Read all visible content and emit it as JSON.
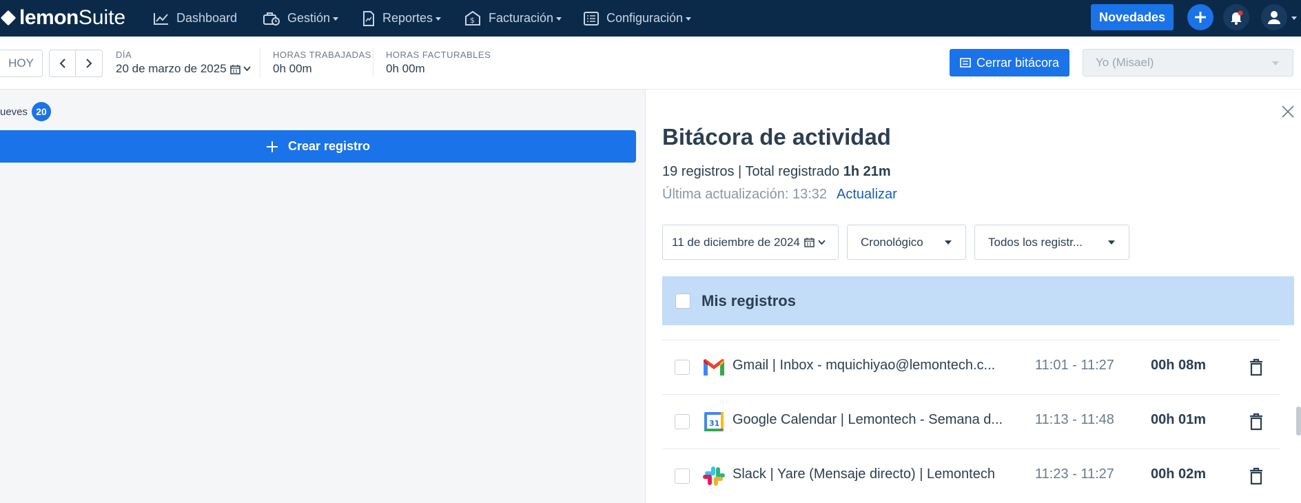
{
  "app": {
    "logo_bold": "lemon",
    "logo_light": "Suite"
  },
  "nav": {
    "items": [
      {
        "label": "Dashboard",
        "icon": "chart-line-icon"
      },
      {
        "label": "Gestión",
        "icon": "briefcase-clock-icon"
      },
      {
        "label": "Reportes",
        "icon": "report-document-icon"
      },
      {
        "label": "Facturación",
        "icon": "money-envelope-icon"
      },
      {
        "label": "Configuración",
        "icon": "list-settings-icon"
      }
    ],
    "novedades": "Novedades"
  },
  "toolbar": {
    "today": "HOY",
    "day_label": "DÍA",
    "day_value": "20 de marzo de 2025",
    "worked_label": "HORAS TRABAJADAS",
    "worked_value": "0h 00m",
    "billable_label": "HORAS FACTURABLES",
    "billable_value": "0h 00m",
    "close_log": "Cerrar bitácora",
    "user_select": "Yo (Misael)"
  },
  "left": {
    "day_name": "ueves",
    "day_number": "20",
    "create_record": "Crear registro"
  },
  "panel": {
    "title": "Bitácora de actividad",
    "summary_prefix": "19 registros | Total registrado ",
    "summary_total": "1h 21m",
    "last_update": "Última actualización: 13:32",
    "refresh": "Actualizar",
    "filters": {
      "date": "11 de diciembre de 2024",
      "order": "Cronológico",
      "records": "Todos los registr..."
    },
    "group_title": "Mis registros",
    "rows": [
      {
        "app": "gmail",
        "title": "Gmail | Inbox - mquichiyao@lemontech.c...",
        "time": "11:01 - 11:27",
        "duration": "00h 08m"
      },
      {
        "app": "google-calendar",
        "title": "Google Calendar | Lemontech - Semana d...",
        "time": "11:13 - 11:48",
        "duration": "00h 01m"
      },
      {
        "app": "slack",
        "title": "Slack | Yare (Mensaje directo) | Lemontech",
        "time": "11:23 - 11:27",
        "duration": "00h 02m"
      }
    ]
  },
  "colors": {
    "nav_bg": "#0b2a4a",
    "primary": "#1a73e8",
    "group_bg": "#c3dcf7",
    "left_bg": "#f5f6f8"
  }
}
